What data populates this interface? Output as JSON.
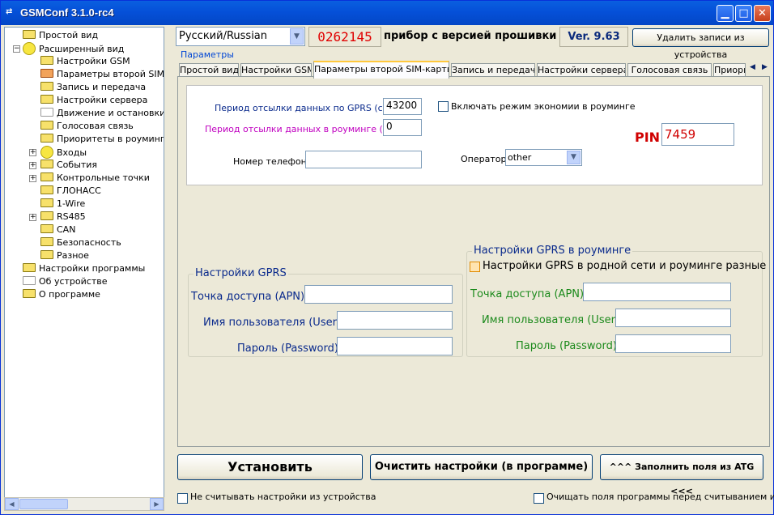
{
  "window": {
    "title": "GSMConf 3.1.0-rc4",
    "icon": "app-icon"
  },
  "tree": {
    "items": [
      {
        "label": "Простой вид",
        "icon": "folder"
      },
      {
        "label": "Расширенный вид",
        "icon": "circle"
      },
      {
        "label": "Настройки GSM",
        "icon": "folder"
      },
      {
        "label": "Параметры второй SIM-к",
        "icon": "folder-open"
      },
      {
        "label": "Запись и передача",
        "icon": "folder"
      },
      {
        "label": "Настройки сервера",
        "icon": "folder"
      },
      {
        "label": "Движение и остановки",
        "icon": "folder-gray"
      },
      {
        "label": "Голосовая связь",
        "icon": "folder"
      },
      {
        "label": "Приоритеты в роуминге",
        "icon": "folder"
      },
      {
        "label": "Входы",
        "icon": "circle"
      },
      {
        "label": "События",
        "icon": "folder"
      },
      {
        "label": "Контрольные точки",
        "icon": "folder"
      },
      {
        "label": "ГЛОНАСС",
        "icon": "folder"
      },
      {
        "label": "1-Wire",
        "icon": "folder"
      },
      {
        "label": "RS485",
        "icon": "folder"
      },
      {
        "label": "CAN",
        "icon": "folder"
      },
      {
        "label": "Безопасность",
        "icon": "folder"
      },
      {
        "label": "Разное",
        "icon": "folder"
      },
      {
        "label": "Настройки программы",
        "icon": "folder"
      },
      {
        "label": "Об устройстве",
        "icon": "folder-gray"
      },
      {
        "label": "О программе",
        "icon": "folder"
      }
    ]
  },
  "header": {
    "language": "Русский/Russian",
    "serial": "0262145",
    "firmware_label": "прибор с версией прошивки",
    "version": "Ver. 9.63",
    "delete_button": "Удалить записи из устройства"
  },
  "params_group": "Параметры",
  "tabs": [
    {
      "label": "Простой вид",
      "active": false
    },
    {
      "label": "Настройки GSM",
      "active": false
    },
    {
      "label": "Параметры второй SIM-карты",
      "active": true
    },
    {
      "label": "Запись и передача",
      "active": false
    },
    {
      "label": "Настройки сервера",
      "active": false
    },
    {
      "label": "Голосовая связь",
      "active": false
    },
    {
      "label": "Приори",
      "active": false
    }
  ],
  "form": {
    "gprs_period_label": "Период отсылки данных по GPRS (сек):",
    "gprs_period_value": "43200",
    "roaming_period_label": "Период отсылки данных в роуминге (сек):",
    "roaming_period_value": "0",
    "economy_label": "Включать режим экономии в роуминге",
    "pin_label": "PIN",
    "pin_value": "7459",
    "phone_label": "Номер телефона",
    "phone_value": "",
    "operator_label": "Оператор",
    "operator_value": "other"
  },
  "gprs": {
    "title": "Настройки GPRS",
    "apn_label": "Точка доступа (APN)",
    "user_label": "Имя пользователя (User)",
    "password_label": "Пароль (Password)"
  },
  "gprs_roaming": {
    "title": "Настройки GPRS в роуминге",
    "different_label": "Настройки GPRS в родной сети и роуминге разные",
    "apn_label": "Точка доступа (APN)",
    "user_label": "Имя пользователя (User)",
    "password_label": "Пароль (Password)"
  },
  "buttons": {
    "install": "Установить",
    "clear": "Очистить настройки (в программе)",
    "fill_atg": "^^^ Заполнить поля из ATG <<<"
  },
  "bottom": {
    "no_read_label": "Не считывать настройки из устройства",
    "clear_before_read_label": "Очищать поля программы перед считыванием из atg"
  },
  "colors": {
    "titlebar": "#0550d8",
    "serial": "#e00000",
    "pin": "#d00000",
    "accent_blue": "#0a2a8c",
    "roaming_green": "#1c8a1c"
  }
}
